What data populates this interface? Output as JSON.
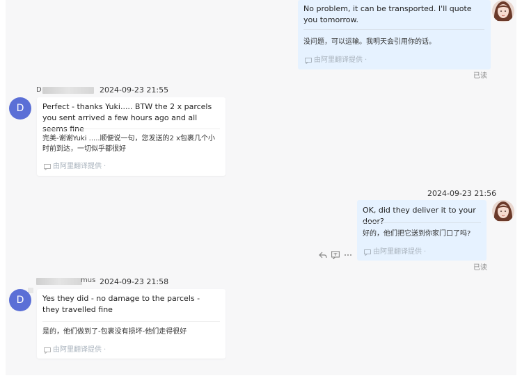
{
  "messages": [
    {
      "id": "m1",
      "direction": "out",
      "original": "No problem, it can be transported. I'll quote you tomorrow.",
      "translation": "没问题，可以运输。我明天会引用你的话。",
      "provider": "由阿里翻译提供",
      "status": "已读"
    },
    {
      "id": "m2",
      "direction": "in",
      "sender_initial": "D",
      "sender_name_partial": "D",
      "timestamp": "2024-09-23 21:55",
      "avatar_letter": "D",
      "original": "Perfect - thanks Yuki..... BTW the 2 x parcels you sent arrived a few hours ago and all seems fine",
      "translation": "完美-谢谢Yuki .....顺便说一句，您发送的2 x包裹几个小时前到达，一切似乎都很好",
      "provider": "由阿里翻译提供"
    },
    {
      "id": "m3",
      "direction": "out",
      "timestamp": "2024-09-23 21:56",
      "original": "OK, did they deliver it to your door?",
      "translation": "好的，他们把它送到你家门口了吗?",
      "provider": "由阿里翻译提供",
      "status": "已读"
    },
    {
      "id": "m4",
      "direction": "in",
      "sender_name_partial": "D",
      "sender_name_tail": "mus",
      "timestamp": "2024-09-23 21:58",
      "avatar_letter": "D",
      "original": "Yes they did - no damage to the parcels - they travelled fine",
      "translation": "是的，他们做到了-包裹没有损坏-他们走得很好",
      "provider": "由阿里翻译提供"
    }
  ],
  "colors": {
    "outgoing_bubble": "#e6f2ff",
    "incoming_bubble": "#ffffff",
    "avatar_d": "#5b6fd6",
    "pane_background": "#f7f7f8"
  },
  "icons": {
    "reply": "reply-icon",
    "translate": "translate-icon",
    "more": "more-icon",
    "provider": "translate-source-icon"
  }
}
